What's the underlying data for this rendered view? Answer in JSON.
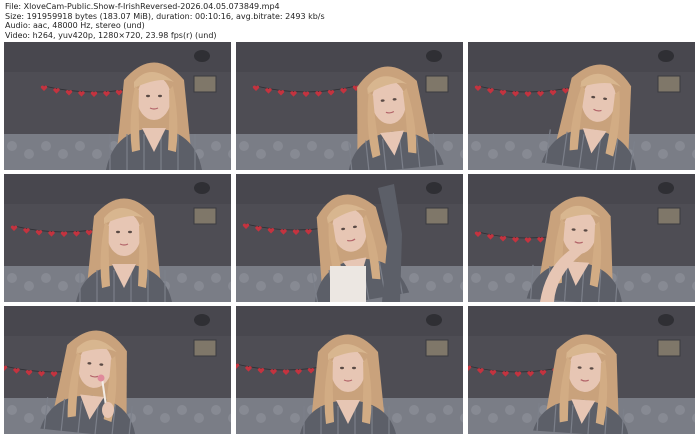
{
  "info": {
    "file": "File: XloveCam-Public.Show-f-IrishReversed-2026.04.05.073849.mp4",
    "size": "Size: 191959918 bytes (183.07 MiB), duration: 00:10:16, avg.bitrate: 2493 kb/s",
    "audio": "Audio: aac, 48000 Hz, stereo (und)",
    "video": "Video: h264, yuv420p, 1280×720, 23.98 fps(r) (und)"
  },
  "thumbnails": [
    {
      "pose": "hands-down"
    },
    {
      "pose": "leaning"
    },
    {
      "pose": "tilted"
    },
    {
      "pose": "neutral"
    },
    {
      "pose": "arm-raised"
    },
    {
      "pose": "hand-to-mouth"
    },
    {
      "pose": "lollipop"
    },
    {
      "pose": "looking-down"
    },
    {
      "pose": "looking-down-right"
    }
  ],
  "colors": {
    "wall": "#4e4d54",
    "blanket": "#7a7d86",
    "hair": "#c9a27c",
    "skin": "#e7c6b4",
    "shirt": "#5c5f68",
    "hearts": "#c4333f"
  }
}
